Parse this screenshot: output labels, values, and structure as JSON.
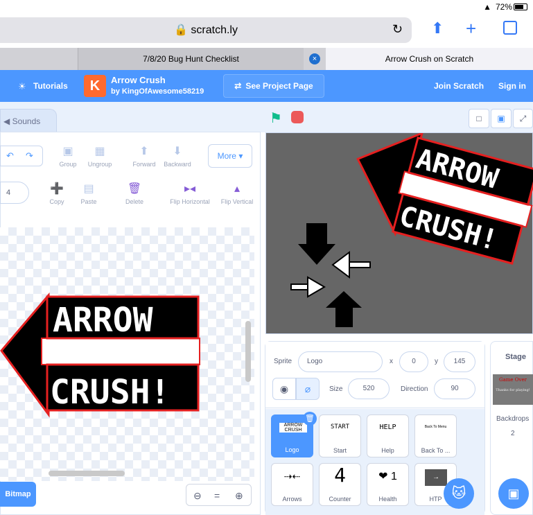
{
  "status": {
    "wifi": "◔",
    "battery": "72%"
  },
  "browser": {
    "url": "🔒 scratch.ly",
    "tabs": [
      {
        "label": "7/8/20 Bug Hunt Checklist"
      },
      {
        "label": "Arrow Crush on Scratch"
      }
    ],
    "tab_close": "×"
  },
  "menu": {
    "tutorials": "Tutorials",
    "logo_letter": "K",
    "project_title": "Arrow Crush",
    "project_by": "by KingOfAwesome58219",
    "see_project": "See Project Page",
    "join": "Join Scratch",
    "sign_in": "Sign in"
  },
  "editor": {
    "sounds_tab": "Sounds",
    "tools_row1": [
      {
        "label": "Group",
        "icon": "group-icon"
      },
      {
        "label": "Ungroup",
        "icon": "ungroup-icon"
      },
      {
        "label": "Forward",
        "icon": "forward-icon"
      },
      {
        "label": "Backward",
        "icon": "backward-icon"
      }
    ],
    "more": "More ▾",
    "brush_size": "4",
    "tools_row2": [
      {
        "label": "Copy",
        "icon": "copy-icon"
      },
      {
        "label": "Paste",
        "icon": "paste-icon"
      },
      {
        "label": "Delete",
        "icon": "delete-icon"
      },
      {
        "label": "Flip Horizontal",
        "icon": "flip-horizontal-icon"
      },
      {
        "label": "Flip Vertical",
        "icon": "flip-vertical-icon"
      }
    ],
    "costume_text_1": "ARROW",
    "costume_text_2": "CRUSH!",
    "bitmap": "Bitmap",
    "zoom_out": "⊖",
    "zoom_reset": "=",
    "zoom_in": "⊕"
  },
  "stage_text_1": "ARROW",
  "stage_text_2": "CRUSH!",
  "sprite_info": {
    "sprite_label": "Sprite",
    "name": "Logo",
    "x_label": "x",
    "x": "0",
    "y_label": "y",
    "y": "145",
    "size_label": "Size",
    "size": "520",
    "direction_label": "Direction",
    "direction": "90"
  },
  "sprites": [
    {
      "name": "Logo",
      "thumb": "ARROW CRUSH"
    },
    {
      "name": "Start",
      "thumb": "START"
    },
    {
      "name": "Help",
      "thumb": "HELP"
    },
    {
      "name": "Back To ...",
      "thumb": "Back To Menu"
    },
    {
      "name": "Arrows",
      "thumb": "⇢⇠"
    },
    {
      "name": "Counter",
      "thumb": "4"
    },
    {
      "name": "Health",
      "thumb": "❤ 1"
    },
    {
      "name": "HTP",
      "thumb": "→"
    }
  ],
  "stage_panel": {
    "label": "Stage",
    "backdrop_line1": "Game Over",
    "backdrop_line2": "Thanks for playing!",
    "backdrops_label": "Backdrops",
    "backdrops_count": "2"
  }
}
